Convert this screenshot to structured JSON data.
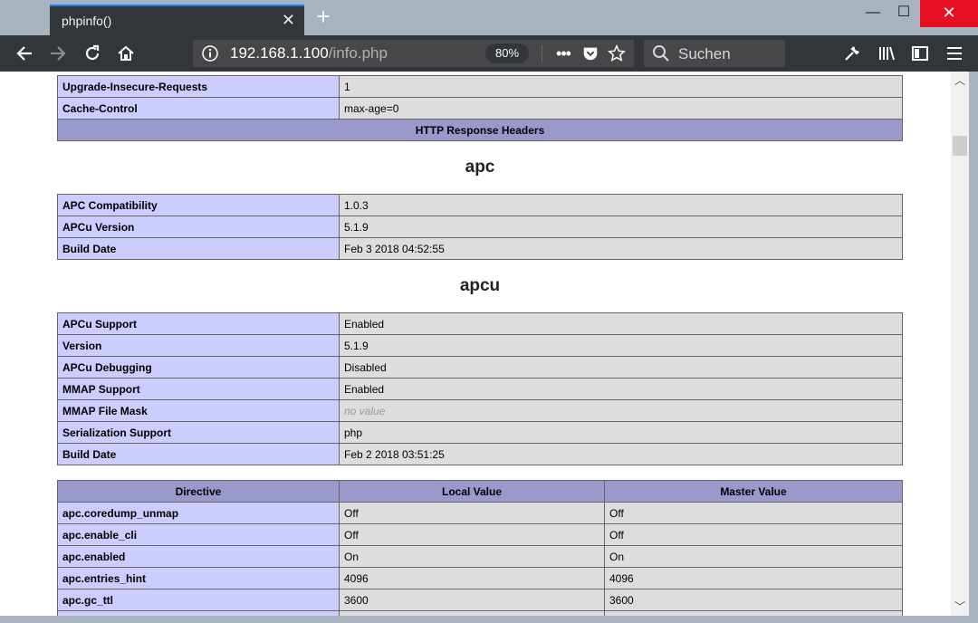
{
  "browser": {
    "tab_title": "phpinfo()",
    "url_host": "192.168.1.100",
    "url_path": "/info.php",
    "zoom": "80%",
    "search_placeholder": "Suchen"
  },
  "top_table": {
    "rows": [
      {
        "key": "Upgrade-Insecure-Requests",
        "value": "1"
      },
      {
        "key": "Cache-Control",
        "value": "max-age=0"
      }
    ],
    "header": "HTTP Response Headers"
  },
  "apc": {
    "title": "apc",
    "rows": [
      {
        "key": "APC Compatibility",
        "value": "1.0.3"
      },
      {
        "key": "APCu Version",
        "value": "5.1.9"
      },
      {
        "key": "Build Date",
        "value": "Feb 3 2018 04:52:55"
      }
    ]
  },
  "apcu": {
    "title": "apcu",
    "rows": [
      {
        "key": "APCu Support",
        "value": "Enabled"
      },
      {
        "key": "Version",
        "value": "5.1.9"
      },
      {
        "key": "APCu Debugging",
        "value": "Disabled"
      },
      {
        "key": "MMAP Support",
        "value": "Enabled"
      },
      {
        "key": "MMAP File Mask",
        "value": "no value"
      },
      {
        "key": "Serialization Support",
        "value": "php"
      },
      {
        "key": "Build Date",
        "value": "Feb 2 2018 03:51:25"
      }
    ]
  },
  "directives": {
    "headers": [
      "Directive",
      "Local Value",
      "Master Value"
    ],
    "rows": [
      {
        "name": "apc.coredump_unmap",
        "local": "Off",
        "master": "Off"
      },
      {
        "name": "apc.enable_cli",
        "local": "Off",
        "master": "Off"
      },
      {
        "name": "apc.enabled",
        "local": "On",
        "master": "On"
      },
      {
        "name": "apc.entries_hint",
        "local": "4096",
        "master": "4096"
      },
      {
        "name": "apc.gc_ttl",
        "local": "3600",
        "master": "3600"
      }
    ]
  },
  "colors": {
    "key_cell": "#ccccff",
    "value_cell": "#dddddd",
    "header_cell": "#9999cc",
    "toolbar": "#323639",
    "titlebar": "#a7b3bf",
    "close_button": "#e81123"
  }
}
